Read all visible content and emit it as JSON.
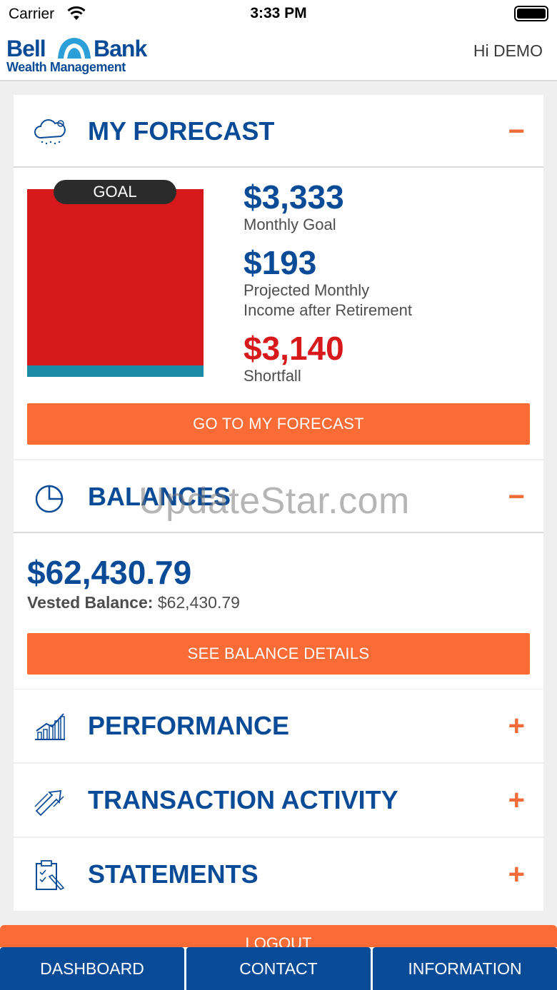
{
  "status_bar": {
    "carrier": "Carrier",
    "time": "3:33 PM"
  },
  "header": {
    "logo_bell": "Bell",
    "logo_bank": "Bank",
    "logo_sub": "Wealth Management",
    "greeting": "Hi DEMO"
  },
  "forecast": {
    "title": "MY FORECAST",
    "toggle": "−",
    "goal_badge": "GOAL",
    "monthly_goal_value": "$3,333",
    "monthly_goal_label": "Monthly Goal",
    "projected_value": "$193",
    "projected_label_1": "Projected Monthly",
    "projected_label_2": "Income after Retirement",
    "shortfall_value": "$3,140",
    "shortfall_label": "Shortfall",
    "button": "GO TO MY FORECAST"
  },
  "balances": {
    "title": "BALANCES",
    "toggle": "−",
    "value": "$62,430.79",
    "vested_label": "Vested Balance:",
    "vested_value": "$62,430.79",
    "button": "SEE BALANCE DETAILS"
  },
  "sections": [
    {
      "title": "PERFORMANCE",
      "toggle": "+"
    },
    {
      "title": "TRANSACTION ACTIVITY",
      "toggle": "+"
    },
    {
      "title": "STATEMENTS",
      "toggle": "+"
    }
  ],
  "watermark": "UpdateStar.com",
  "logout": "LOGOUT",
  "tabs": [
    "DASHBOARD",
    "CONTACT",
    "INFORMATION"
  ],
  "colors": {
    "brand_blue": "#0a4b97",
    "accent_orange": "#fb6b35",
    "shortfall_red": "#d7191b",
    "projected_teal": "#1b8aa6"
  }
}
